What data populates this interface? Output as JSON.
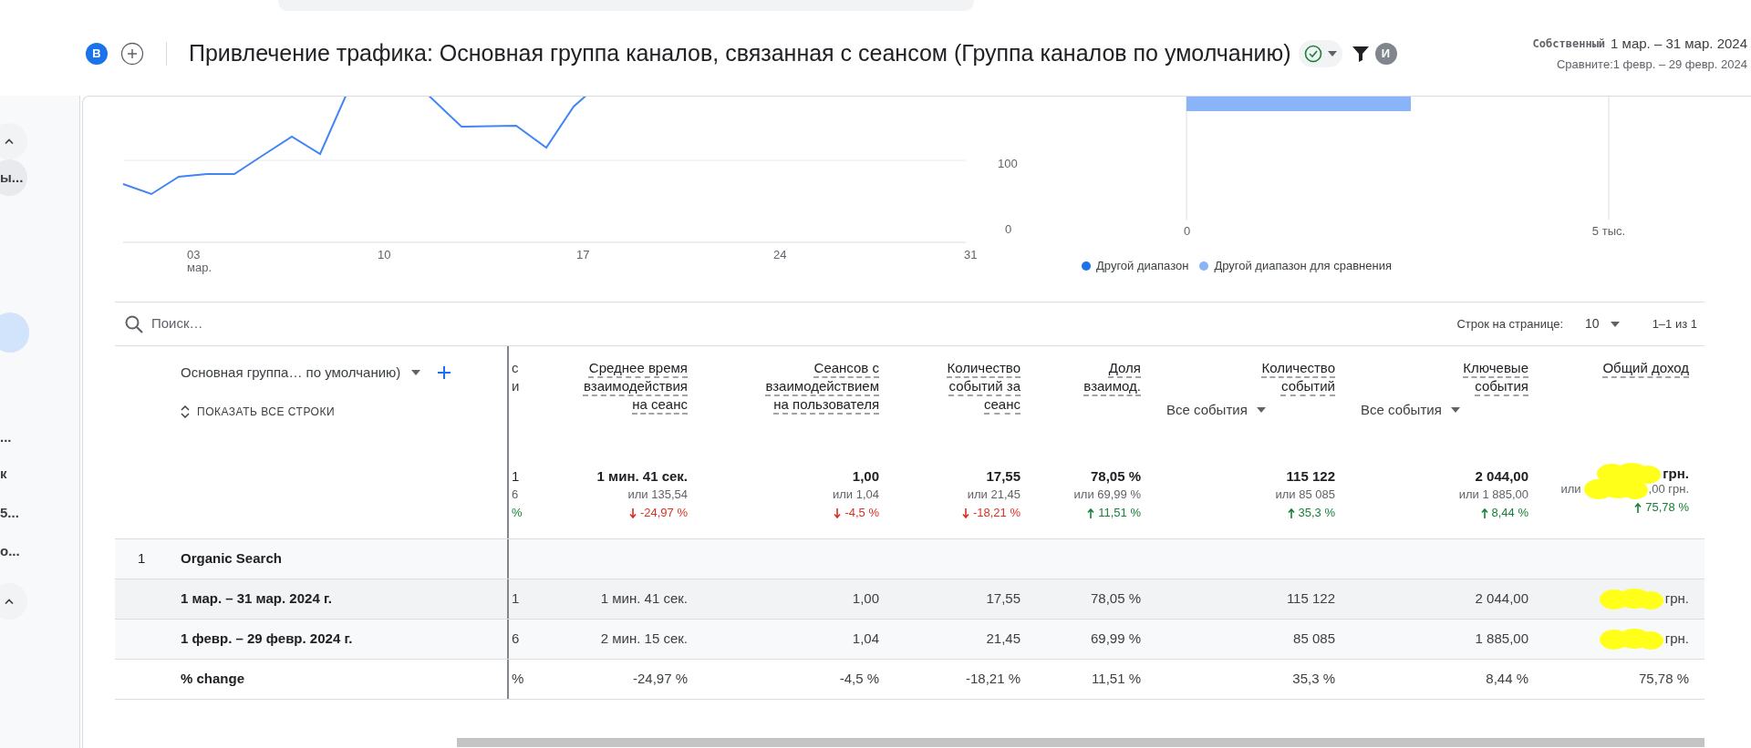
{
  "header": {
    "avatar": "B",
    "title": "Привлечение трафика: Основная группа каналов, связанная с сеансом (Группа каналов по умолчанию)",
    "user_avatar": "И",
    "property": "Собственный",
    "date_range": "1 мар. – 31 мар. 2024",
    "compare": "Сравните:1 февр. – 29 февр. 2024"
  },
  "sidebar": {
    "items": [
      {
        "kind": "caret"
      },
      {
        "kind": "text",
        "label": "ы...",
        "selected": false
      },
      {
        "kind": "pill",
        "selected": true
      },
      {
        "kind": "text",
        "label": "...",
        "selected": false
      },
      {
        "kind": "text",
        "label": "к",
        "selected": false
      },
      {
        "kind": "text",
        "label": "5...",
        "selected": false
      },
      {
        "kind": "text",
        "label": "о...",
        "selected": false
      },
      {
        "kind": "caret"
      }
    ]
  },
  "line_chart": {
    "y_labels": [
      "100",
      "0"
    ],
    "x_labels": [
      {
        "day": "03",
        "month": "мар."
      },
      {
        "day": "10"
      },
      {
        "day": "17"
      },
      {
        "day": "24"
      },
      {
        "day": "31"
      }
    ]
  },
  "bar_chart": {
    "x_labels": [
      "0",
      "5 тыс."
    ],
    "legend": [
      {
        "label": "Другой диапазон",
        "color": "#1a73e8"
      },
      {
        "label": "Другой диапазон для сравнения",
        "color": "#8ab4f8"
      }
    ]
  },
  "table": {
    "search_placeholder": "Поиск…",
    "rows_per_page_label": "Строк на странице:",
    "rows_per_page": "10",
    "pagination": "1–1 из 1",
    "dimension_header": "Основная группа… по умолчанию)",
    "show_all": "ПОКАЗАТЬ ВСЕ СТРОКИ",
    "cut_header": [
      "с",
      "и"
    ],
    "columns": [
      {
        "lines": [
          "Среднее время",
          "взаимодействия",
          "на сеанс"
        ]
      },
      {
        "lines": [
          "Сеансов с",
          "взаимодействием",
          "на пользователя"
        ]
      },
      {
        "lines": [
          "Количество",
          "событий за",
          "сеанс"
        ]
      },
      {
        "lines": [
          "Доля",
          "взаимод."
        ]
      },
      {
        "lines": [
          "Количество",
          "событий"
        ],
        "filter": "Все события"
      },
      {
        "lines": [
          "Ключевые",
          "события"
        ],
        "filter": "Все события"
      },
      {
        "lines": [
          "Общий доход"
        ]
      }
    ],
    "totals": {
      "cut": [
        "1",
        "6",
        "%"
      ],
      "cells": [
        {
          "value": "1 мин. 41 сек.",
          "compare": "или 135,54",
          "change": "-24,97 %",
          "increase": false
        },
        {
          "value": "1,00",
          "compare": "или 1,04",
          "change": "-4,5 %",
          "increase": false
        },
        {
          "value": "17,55",
          "compare": "или 21,45",
          "change": "-18,21 %",
          "increase": false
        },
        {
          "value": "78,05 %",
          "compare": "или 69,99 %",
          "change": "11,51 %",
          "increase": true
        },
        {
          "value": "115 122",
          "compare": "или 85 085",
          "change": "35,3 %",
          "increase": true
        },
        {
          "value": "2 044,00",
          "compare": "или 1 885,00",
          "change": "8,44 %",
          "increase": true
        },
        {
          "value": "грн.",
          "compare": "или",
          "compare_tail": ",00 грн.",
          "change": "75,78 %",
          "increase": true,
          "redacted": true
        }
      ]
    },
    "rows": [
      {
        "kind": "group",
        "index": "1",
        "label": "Organic Search"
      },
      {
        "kind": "data",
        "label": "1 мар. – 31 мар. 2024 г.",
        "cut": "1",
        "cells": [
          {
            "text": "1 мин. 41 сек."
          },
          {
            "text": "1,00"
          },
          {
            "text": "17,55"
          },
          {
            "text": "78,05 %"
          },
          {
            "text": "115 122"
          },
          {
            "text": "2 044,00"
          },
          {
            "text": "грн.",
            "redacted": true
          }
        ]
      },
      {
        "kind": "data",
        "label": "1 февр. – 29 февр. 2024 г.",
        "cut": "6",
        "cells": [
          {
            "text": "2 мин. 15 сек."
          },
          {
            "text": "1,04"
          },
          {
            "text": "21,45"
          },
          {
            "text": "69,99 %"
          },
          {
            "text": "85 085"
          },
          {
            "text": "1 885,00"
          },
          {
            "text": "грн.",
            "redacted": true
          }
        ]
      },
      {
        "kind": "data",
        "label": "% change",
        "cut": "%",
        "cells": [
          {
            "text": "-24,97 %"
          },
          {
            "text": "-4,5 %"
          },
          {
            "text": "-18,21 %"
          },
          {
            "text": "11,51 %"
          },
          {
            "text": "35,3 %"
          },
          {
            "text": "8,44 %"
          },
          {
            "text": "75,78 %"
          }
        ]
      }
    ]
  }
}
